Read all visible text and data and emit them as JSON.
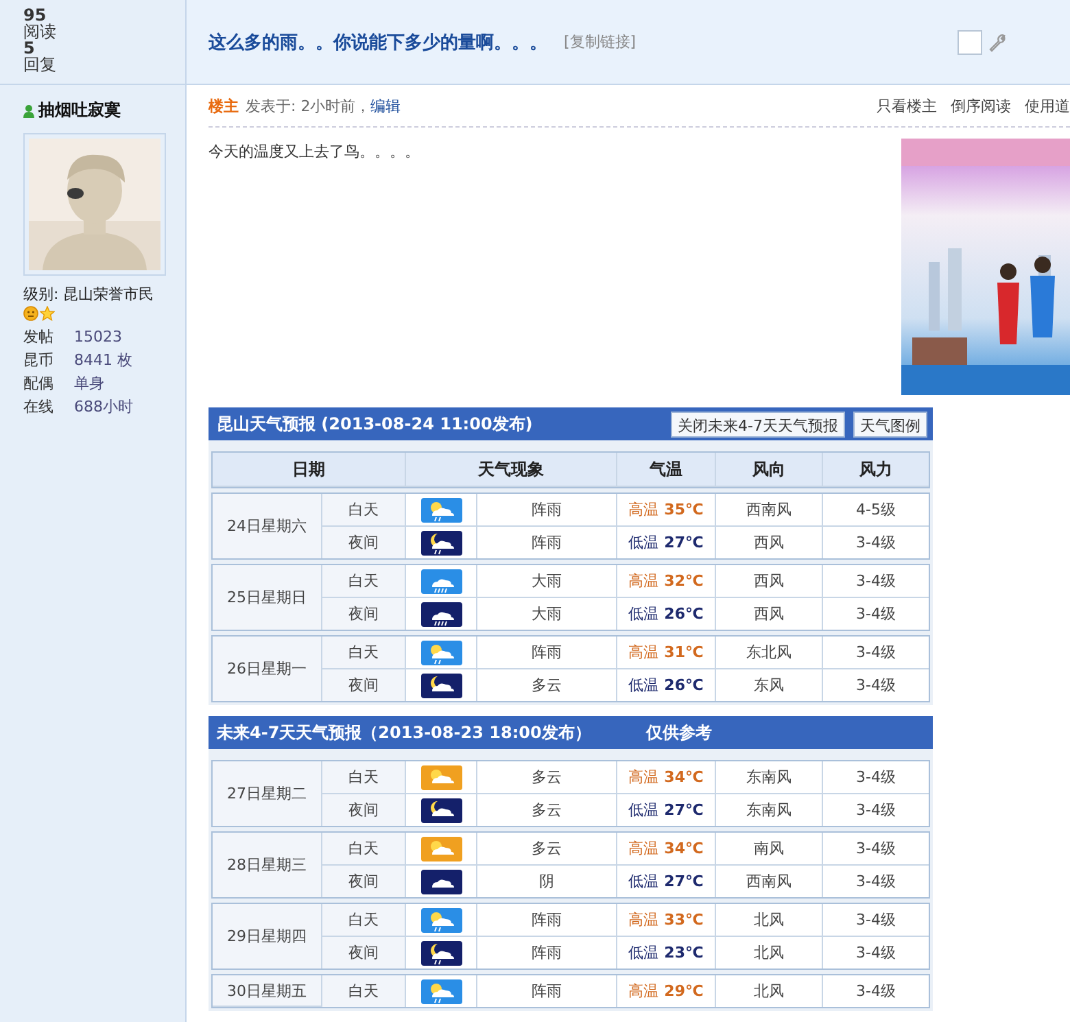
{
  "thread_stats": {
    "views": "95",
    "views_label": "阅读",
    "replies": "5",
    "replies_label": "回复"
  },
  "thread": {
    "title": "这么多的雨。。你说能下多少的量啊。。。",
    "copy_link": "[复制链接]",
    "checkbox_checked": false
  },
  "author": {
    "name": "抽烟吐寂寞",
    "level": "级别: 昆山荣誉市民",
    "stats": [
      {
        "label": "发帖",
        "value": "15023"
      },
      {
        "label": "昆币",
        "value": "8441 枚"
      },
      {
        "label": "配偶",
        "value": "单身"
      },
      {
        "label": "在线",
        "value": "688小时"
      }
    ]
  },
  "post_meta": {
    "badge": "楼主",
    "posted": "发表于: 2小时前，",
    "edit": "编辑",
    "actions": [
      "只看楼主",
      "倒序阅读",
      "使用道"
    ]
  },
  "post": {
    "text": "今天的温度又上去了鸟。。。。"
  },
  "forecasts": [
    {
      "title": "昆山天气预报 (2013-08-24  11:00发布)",
      "buttons": [
        "关闭未来4-7天天气预报",
        "天气图例"
      ],
      "columns": [
        "日期",
        "天气现象",
        "气温",
        "风向",
        "风力"
      ],
      "days": [
        {
          "date": "24日星期六",
          "periods": [
            {
              "period": "白天",
              "kind": "shower",
              "night": false,
              "weather": "阵雨",
              "temp": {
                "kind": "high",
                "label": "高温",
                "value": "35℃"
              },
              "wind_dir": "西南风",
              "wind_force": "4-5级"
            },
            {
              "period": "夜间",
              "kind": "shower",
              "night": true,
              "weather": "阵雨",
              "temp": {
                "kind": "low",
                "label": "低温",
                "value": "27℃"
              },
              "wind_dir": "西风",
              "wind_force": "3-4级"
            }
          ]
        },
        {
          "date": "25日星期日",
          "periods": [
            {
              "period": "白天",
              "kind": "rain",
              "night": false,
              "weather": "大雨",
              "temp": {
                "kind": "high",
                "label": "高温",
                "value": "32℃"
              },
              "wind_dir": "西风",
              "wind_force": "3-4级"
            },
            {
              "period": "夜间",
              "kind": "rain",
              "night": true,
              "weather": "大雨",
              "temp": {
                "kind": "low",
                "label": "低温",
                "value": "26℃"
              },
              "wind_dir": "西风",
              "wind_force": "3-4级"
            }
          ]
        },
        {
          "date": "26日星期一",
          "periods": [
            {
              "period": "白天",
              "kind": "shower",
              "night": false,
              "weather": "阵雨",
              "temp": {
                "kind": "high",
                "label": "高温",
                "value": "31℃"
              },
              "wind_dir": "东北风",
              "wind_force": "3-4级"
            },
            {
              "period": "夜间",
              "kind": "cloudy",
              "night": true,
              "weather": "多云",
              "temp": {
                "kind": "low",
                "label": "低温",
                "value": "26℃"
              },
              "wind_dir": "东风",
              "wind_force": "3-4级"
            }
          ]
        }
      ]
    },
    {
      "title": "未来4-7天天气预报（2013-08-23 18:00发布）",
      "note": "仅供参考",
      "days": [
        {
          "date": "27日星期二",
          "periods": [
            {
              "period": "白天",
              "kind": "cloudy",
              "night": false,
              "weather": "多云",
              "temp": {
                "kind": "high",
                "label": "高温",
                "value": "34℃"
              },
              "wind_dir": "东南风",
              "wind_force": "3-4级"
            },
            {
              "period": "夜间",
              "kind": "cloudy",
              "night": true,
              "weather": "多云",
              "temp": {
                "kind": "low",
                "label": "低温",
                "value": "27℃"
              },
              "wind_dir": "东南风",
              "wind_force": "3-4级"
            }
          ]
        },
        {
          "date": "28日星期三",
          "periods": [
            {
              "period": "白天",
              "kind": "cloudy",
              "night": false,
              "weather": "多云",
              "temp": {
                "kind": "high",
                "label": "高温",
                "value": "34℃"
              },
              "wind_dir": "南风",
              "wind_force": "3-4级"
            },
            {
              "period": "夜间",
              "kind": "overcast",
              "night": true,
              "weather": "阴",
              "temp": {
                "kind": "low",
                "label": "低温",
                "value": "27℃"
              },
              "wind_dir": "西南风",
              "wind_force": "3-4级"
            }
          ]
        },
        {
          "date": "29日星期四",
          "periods": [
            {
              "period": "白天",
              "kind": "shower",
              "night": false,
              "weather": "阵雨",
              "temp": {
                "kind": "high",
                "label": "高温",
                "value": "33℃"
              },
              "wind_dir": "北风",
              "wind_force": "3-4级"
            },
            {
              "period": "夜间",
              "kind": "shower",
              "night": true,
              "weather": "阵雨",
              "temp": {
                "kind": "low",
                "label": "低温",
                "value": "23℃"
              },
              "wind_dir": "北风",
              "wind_force": "3-4级"
            }
          ]
        },
        {
          "date": "30日星期五",
          "periods": [
            {
              "period": "白天",
              "kind": "shower",
              "night": false,
              "weather": "阵雨",
              "temp": {
                "kind": "high",
                "label": "高温",
                "value": "29℃"
              },
              "wind_dir": "北风",
              "wind_force": "3-4级"
            }
          ]
        }
      ]
    }
  ]
}
